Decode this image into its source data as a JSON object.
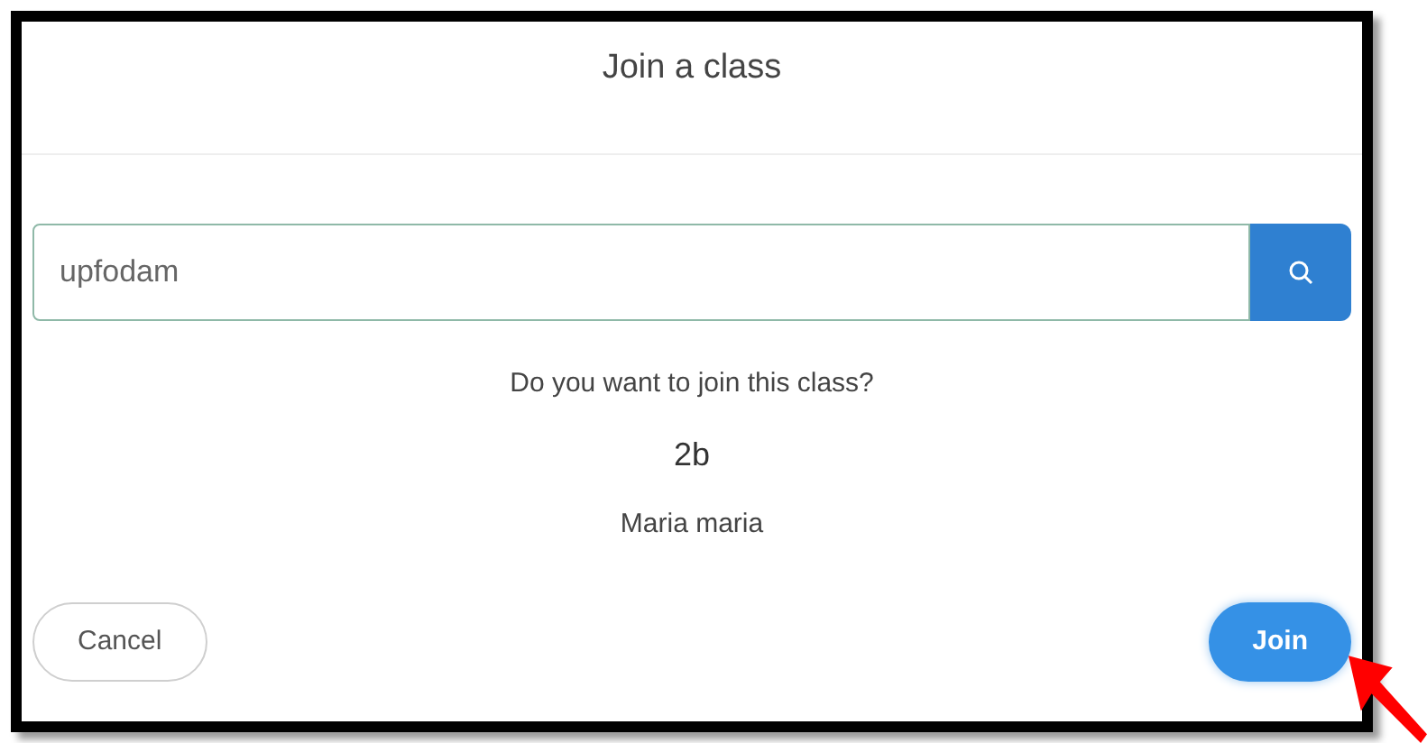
{
  "dialog": {
    "title": "Join a class",
    "search": {
      "value": "upfodam"
    },
    "prompt": "Do you want to join this class?",
    "class_name": "2b",
    "teacher": "Maria maria",
    "buttons": [
      {
        "label": "Cancel",
        "kind": "secondary"
      },
      {
        "label": "Join",
        "kind": "primary"
      }
    ]
  }
}
